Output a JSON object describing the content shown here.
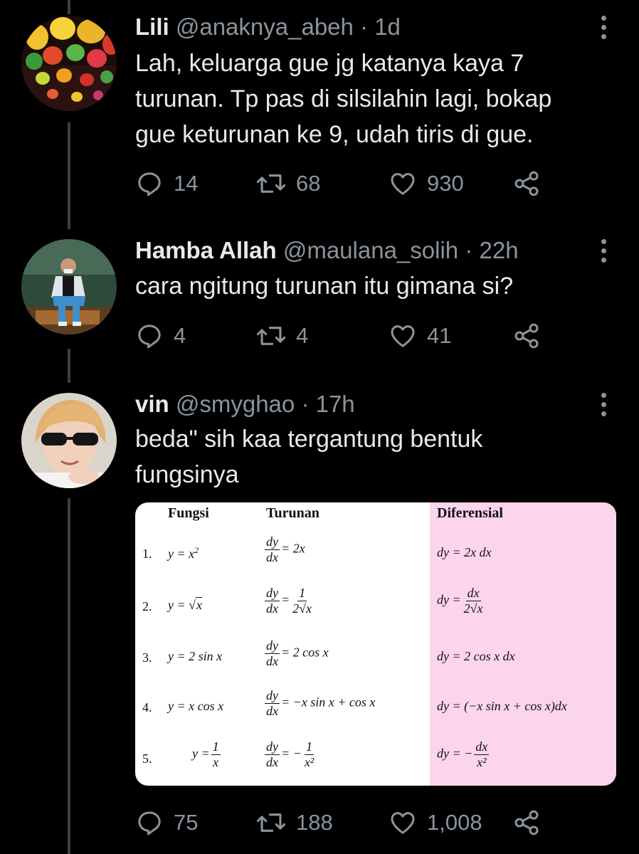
{
  "tweets": [
    {
      "name": "Lili",
      "handle": "@anaknya_abeh",
      "time": "· 1d",
      "text_lines": [
        "Lah, keluarga gue jg katanya kaya 7",
        "turunan. Tp pas di silsilahin lagi, bokap",
        "gue keturunan ke 9, udah tiris di gue."
      ],
      "replies": "14",
      "retweets": "68",
      "likes": "930"
    },
    {
      "name": "Hamba Allah",
      "handle": "@maulana_solih",
      "time": "· 22h",
      "text_lines": [
        "cara ngitung turunan itu gimana si?"
      ],
      "replies": "4",
      "retweets": "4",
      "likes": "41"
    },
    {
      "name": "vin",
      "handle": "@smyghao",
      "time": "· 17h",
      "text_lines": [
        "beda\" sih kaa tergantung bentuk",
        "fungsinya"
      ],
      "replies": "75",
      "retweets": "188",
      "likes": "1,008"
    }
  ],
  "table": {
    "headers": [
      "Fungsi",
      "Turunan",
      "Diferensial"
    ],
    "row_numbers": [
      "1.",
      "2.",
      "3.",
      "4.",
      "5."
    ],
    "text": {
      "y_eq": "y =",
      "dy": "dy",
      "dx": "dx",
      "dy_eq": "dy =",
      "eq": "=",
      "r1_f": "x",
      "r1_exp": "2",
      "r1_t": "= 2x",
      "r1_d": "dy = 2x dx",
      "r2_f": "x",
      "r2_t_num": "1",
      "r2_t_den": "2√x",
      "r2_d_num": "dx",
      "r2_d_den": "2√x",
      "r3_f": "y = 2 sin x",
      "r3_t": "= 2 cos x",
      "r3_d": "dy = 2 cos x dx",
      "r4_f": "y = x cos x",
      "r4_t": "= −x sin x + cos x",
      "r4_d": "dy = (−x sin x + cos x)dx",
      "r5_f_num": "1",
      "r5_f_den": "x",
      "r5_t_num": "1",
      "r5_t_den": "x²",
      "r5_d_num": "dx",
      "r5_d_den": "x²",
      "minus": "−"
    }
  },
  "colors": {
    "background": "#000000",
    "text": "#e7e9ea",
    "muted": "#8b949c",
    "thread_line": "#3c3f43",
    "diferensial_column": "#fcd4ec"
  },
  "icons": [
    "reply-icon",
    "retweet-icon",
    "like-icon",
    "share-icon",
    "more-icon"
  ]
}
